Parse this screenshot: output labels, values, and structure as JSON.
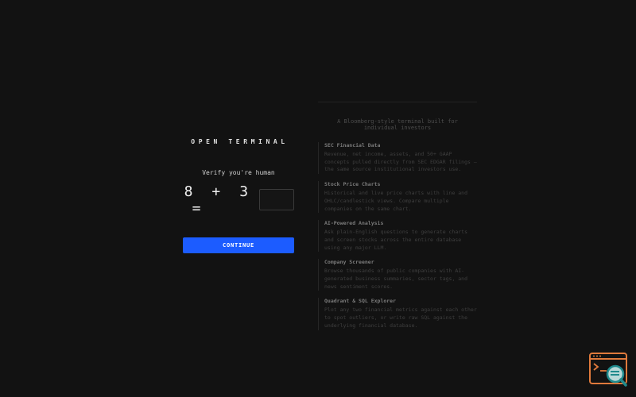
{
  "brand": {
    "name": "OPEN TERMINAL"
  },
  "verify": {
    "prompt": "Verify you're human",
    "captcha": {
      "a": "8",
      "op": "+",
      "b": "3",
      "eq": "="
    },
    "answer_value": "",
    "continue_label": "CONTINUE"
  },
  "info": {
    "tagline": "A Bloomberg-style terminal built for individual investors",
    "features": [
      {
        "title": "SEC Financial Data",
        "desc": "Revenue, net income, assets, and 50+ GAAP concepts pulled directly from SEC EDGAR filings — the same source institutional investors use."
      },
      {
        "title": "Stock Price Charts",
        "desc": "Historical and live price charts with line and OHLC/candlestick views. Compare multiple companies on the same chart."
      },
      {
        "title": "AI-Powered Analysis",
        "desc": "Ask plain-English questions to generate charts and screen stocks across the entire database using any major LLM."
      },
      {
        "title": "Company Screener",
        "desc": "Browse thousands of public companies with AI-generated business summaries, sector tags, and news sentiment scores."
      },
      {
        "title": "Quadrant & SQL Explorer",
        "desc": "Plot any two financial metrics against each other to spot outliers, or write raw SQL against the underlying financial database."
      }
    ]
  },
  "colors": {
    "accent": "#1c5cff",
    "background": "#121212",
    "widget_orange": "#e07a3c",
    "widget_teal": "#1f8a8c"
  },
  "icons": {
    "corner_widget": "terminal-search-icon"
  }
}
